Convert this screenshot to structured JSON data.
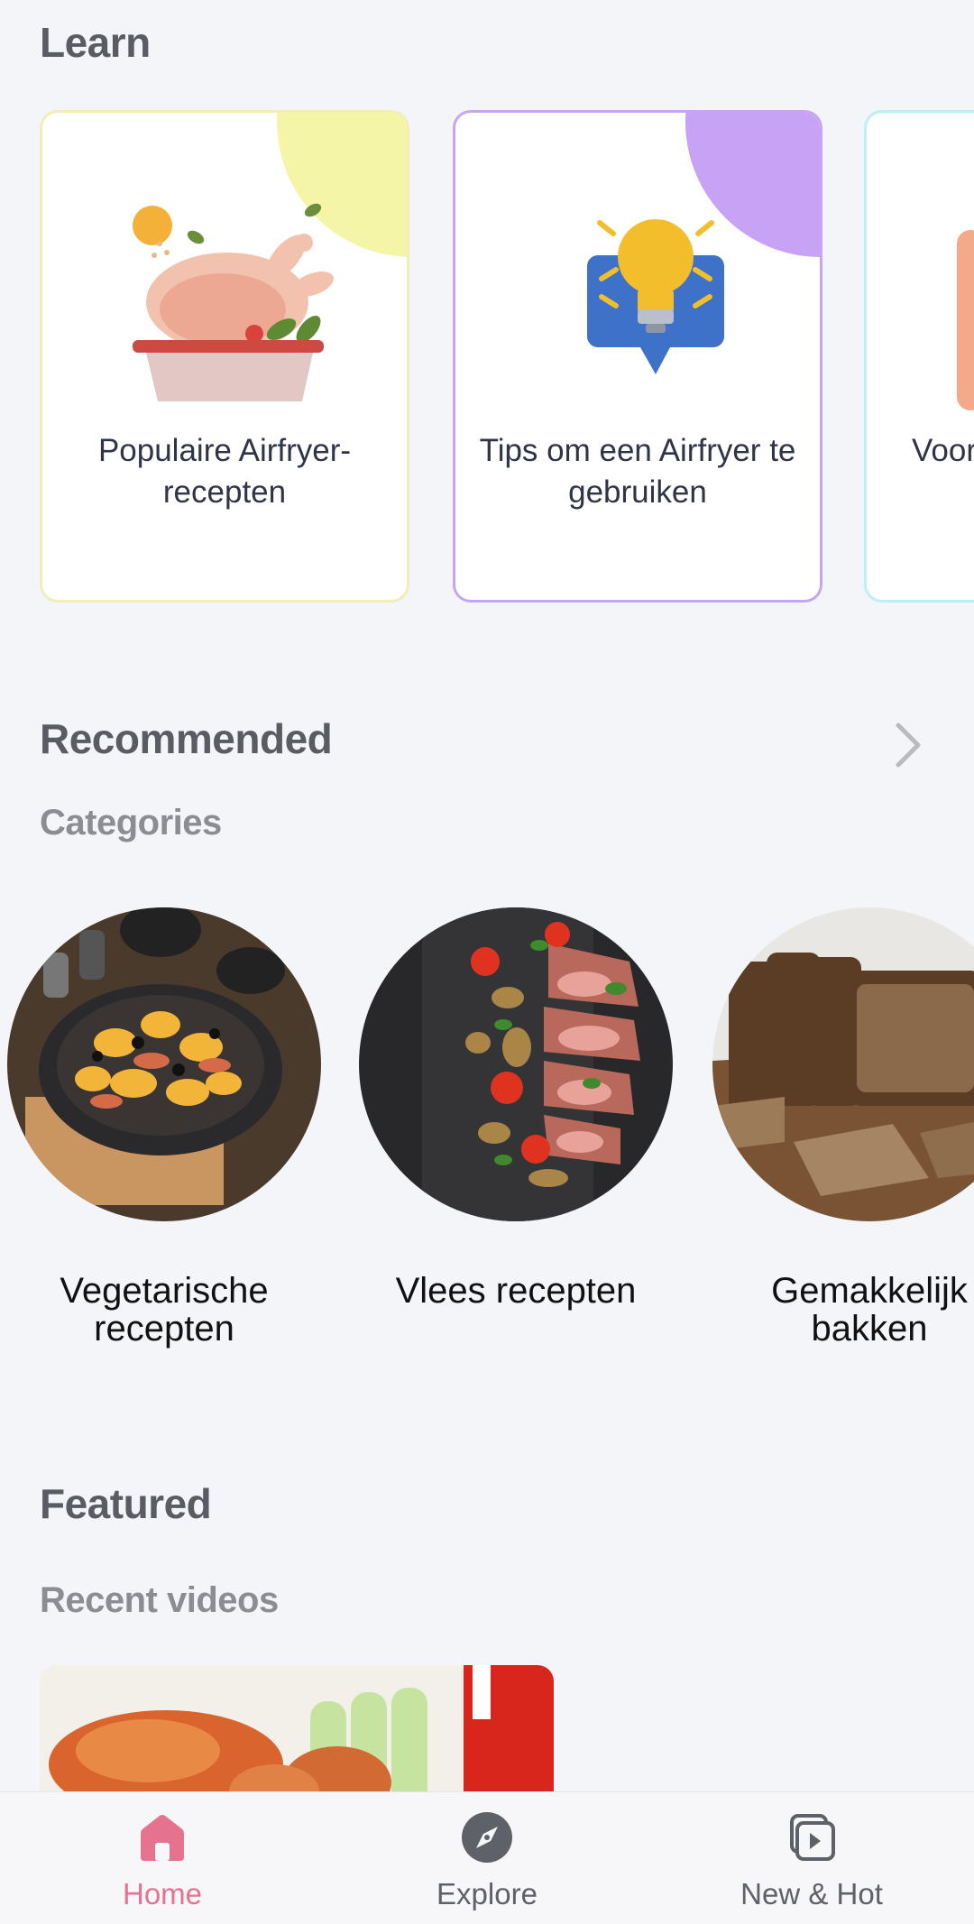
{
  "learn": {
    "title": "Learn",
    "cards": [
      {
        "label": "Populaire Airfryer-recepten",
        "border": "#f1eeb6",
        "accent": "#f4f5a6"
      },
      {
        "label": "Tips om een Airfryer te gebruiken",
        "border": "#c6a6f3",
        "accent": "#c7a2f5"
      },
      {
        "label": "Voor gel",
        "border": "#bdeff3",
        "accent": "#f4a98a"
      }
    ]
  },
  "recommended": {
    "title": "Recommended",
    "subtitle": "Categories",
    "categories": [
      {
        "label": "Vegetarische recepten"
      },
      {
        "label": "Vlees recepten"
      },
      {
        "label": "Gemakkelijk bakken"
      }
    ]
  },
  "featured": {
    "title": "Featured",
    "subtitle": "Recent videos"
  },
  "nav": {
    "items": [
      {
        "label": "Home",
        "icon": "home-icon",
        "active": true
      },
      {
        "label": "Explore",
        "icon": "compass-icon",
        "active": false
      },
      {
        "label": "New & Hot",
        "icon": "video-stack-icon",
        "active": false
      }
    ],
    "active_color": "#e5728f"
  }
}
